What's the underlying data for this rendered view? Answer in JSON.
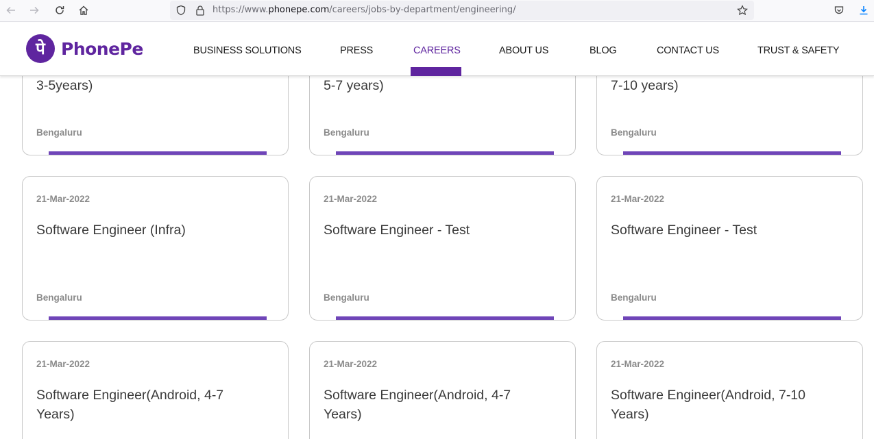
{
  "browser": {
    "url_prefix": "https://www.",
    "url_domain": "phonepe.com",
    "url_path": "/careers/jobs-by-department/engineering/"
  },
  "header": {
    "logo_glyph": "पे",
    "logo_text": "PhonePe",
    "brand_color": "#5f259f",
    "nav": [
      {
        "label": "BUSINESS SOLUTIONS"
      },
      {
        "label": "PRESS"
      },
      {
        "label": "CAREERS",
        "active": true
      },
      {
        "label": "ABOUT US"
      },
      {
        "label": "BLOG"
      },
      {
        "label": "CONTACT US"
      },
      {
        "label": "TRUST & SAFETY"
      }
    ]
  },
  "jobs": {
    "row1": [
      {
        "title": "3-5years)",
        "location": "Bengaluru"
      },
      {
        "title": "5-7 years)",
        "location": "Bengaluru"
      },
      {
        "title": "7-10 years)",
        "location": "Bengaluru"
      }
    ],
    "row2": [
      {
        "date": "21-Mar-2022",
        "title": "Software Engineer (Infra)",
        "location": "Bengaluru"
      },
      {
        "date": "21-Mar-2022",
        "title": "Software Engineer - Test",
        "location": "Bengaluru"
      },
      {
        "date": "21-Mar-2022",
        "title": "Software Engineer - Test",
        "location": "Bengaluru"
      }
    ],
    "row3": [
      {
        "date": "21-Mar-2022",
        "title": "Software Engineer(Android, 4-7 Years)"
      },
      {
        "date": "21-Mar-2022",
        "title": "Software Engineer(Android, 4-7 Years)"
      },
      {
        "date": "21-Mar-2022",
        "title": "Software Engineer(Android, 7-10 Years)"
      }
    ]
  }
}
